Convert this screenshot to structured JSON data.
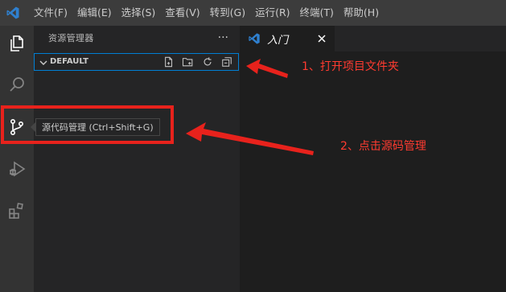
{
  "menu": [
    "文件(F)",
    "编辑(E)",
    "选择(S)",
    "查看(V)",
    "转到(G)",
    "运行(R)",
    "终端(T)",
    "帮助(H)"
  ],
  "sidebar": {
    "title": "资源管理器",
    "more": "···",
    "section_title": "DEFAULT"
  },
  "tooltip": "源代码管理 (Ctrl+Shift+G)",
  "tab": {
    "label": "入门",
    "close": "✕"
  },
  "annotations": {
    "step1": "1、打开项目文件夹",
    "step2": "2、点击源码管理"
  },
  "colors": {
    "accent": "#007fd4",
    "vscode_blue": "#2f80cf",
    "annotation_red": "#e8221c"
  },
  "icons": {
    "activity": [
      "explorer-icon",
      "search-icon",
      "source-control-icon",
      "run-debug-icon",
      "extensions-icon"
    ],
    "section_actions": [
      "new-file-icon",
      "new-folder-icon",
      "refresh-icon",
      "collapse-all-icon"
    ]
  }
}
